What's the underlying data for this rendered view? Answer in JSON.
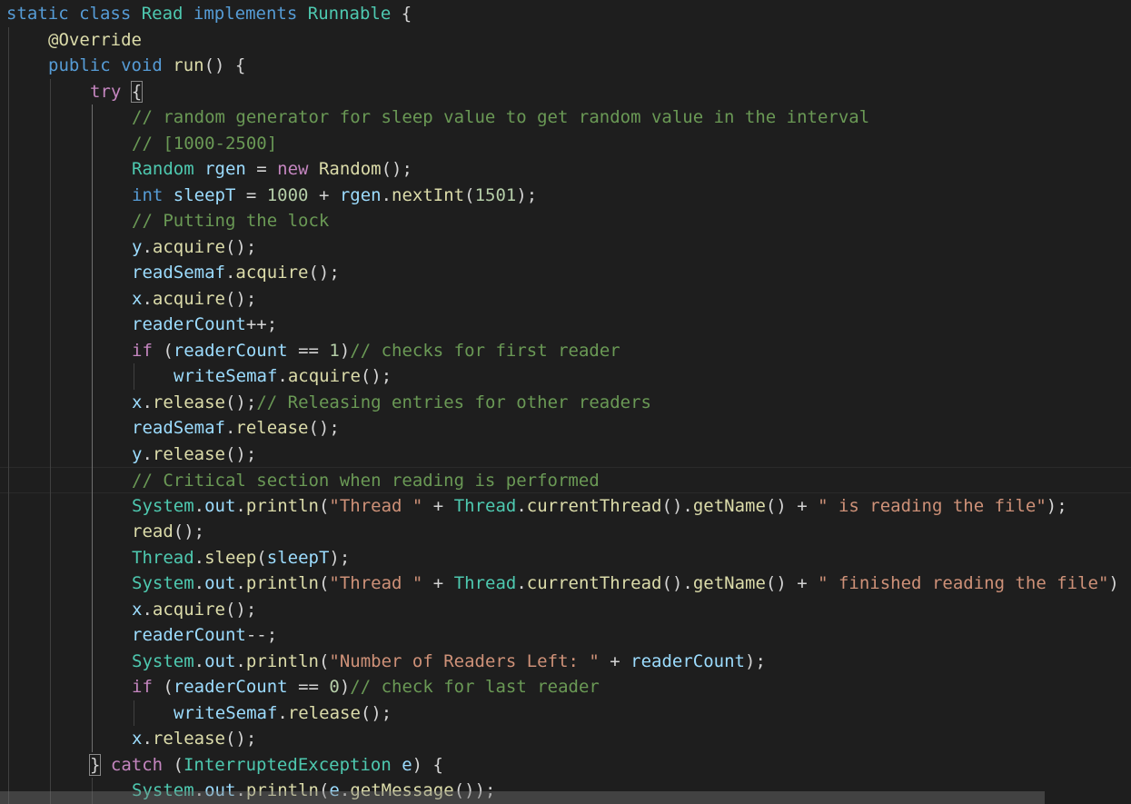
{
  "editor": {
    "language": "java",
    "lines": [
      {
        "indent": 0,
        "tokens": [
          [
            "kw",
            "static "
          ],
          [
            "kw",
            "class "
          ],
          [
            "type",
            "Read "
          ],
          [
            "kw",
            "implements "
          ],
          [
            "type",
            "Runnable"
          ],
          [
            "op",
            " {"
          ]
        ]
      },
      {
        "indent": 1,
        "tokens": [
          [
            "ann",
            "@Override"
          ]
        ]
      },
      {
        "indent": 1,
        "tokens": [
          [
            "kw",
            "public "
          ],
          [
            "kw",
            "void "
          ],
          [
            "fn",
            "run"
          ],
          [
            "op",
            "() {"
          ]
        ]
      },
      {
        "indent": 2,
        "tokens": [
          [
            "ctl",
            "try "
          ],
          [
            "brace",
            "{"
          ]
        ]
      },
      {
        "indent": 3,
        "tokens": [
          [
            "cmt",
            "// random generator for sleep value to get random value in the interval"
          ]
        ]
      },
      {
        "indent": 3,
        "tokens": [
          [
            "cmt",
            "// [1000-2500]"
          ]
        ]
      },
      {
        "indent": 3,
        "tokens": [
          [
            "type",
            "Random "
          ],
          [
            "var",
            "rgen"
          ],
          [
            "op",
            " = "
          ],
          [
            "ctl",
            "new "
          ],
          [
            "fn",
            "Random"
          ],
          [
            "op",
            "();"
          ]
        ]
      },
      {
        "indent": 3,
        "tokens": [
          [
            "kw",
            "int "
          ],
          [
            "var",
            "sleepT"
          ],
          [
            "op",
            " = "
          ],
          [
            "num",
            "1000"
          ],
          [
            "op",
            " + "
          ],
          [
            "var",
            "rgen"
          ],
          [
            "op",
            "."
          ],
          [
            "fn",
            "nextInt"
          ],
          [
            "op",
            "("
          ],
          [
            "num",
            "1501"
          ],
          [
            "op",
            ");"
          ]
        ]
      },
      {
        "indent": 3,
        "tokens": [
          [
            "cmt",
            "// Putting the lock"
          ]
        ]
      },
      {
        "indent": 3,
        "tokens": [
          [
            "var",
            "y"
          ],
          [
            "op",
            "."
          ],
          [
            "fn",
            "acquire"
          ],
          [
            "op",
            "();"
          ]
        ]
      },
      {
        "indent": 3,
        "tokens": [
          [
            "var",
            "readSemaf"
          ],
          [
            "op",
            "."
          ],
          [
            "fn",
            "acquire"
          ],
          [
            "op",
            "();"
          ]
        ]
      },
      {
        "indent": 3,
        "tokens": [
          [
            "var",
            "x"
          ],
          [
            "op",
            "."
          ],
          [
            "fn",
            "acquire"
          ],
          [
            "op",
            "();"
          ]
        ]
      },
      {
        "indent": 3,
        "tokens": [
          [
            "var",
            "readerCount"
          ],
          [
            "op",
            "++;"
          ]
        ]
      },
      {
        "indent": 3,
        "tokens": [
          [
            "ctl",
            "if "
          ],
          [
            "op",
            "("
          ],
          [
            "var",
            "readerCount"
          ],
          [
            "op",
            " == "
          ],
          [
            "num",
            "1"
          ],
          [
            "op",
            ")"
          ],
          [
            "cmt",
            "// checks for first reader"
          ]
        ]
      },
      {
        "indent": 4,
        "tokens": [
          [
            "var",
            "writeSemaf"
          ],
          [
            "op",
            "."
          ],
          [
            "fn",
            "acquire"
          ],
          [
            "op",
            "();"
          ]
        ]
      },
      {
        "indent": 3,
        "tokens": [
          [
            "var",
            "x"
          ],
          [
            "op",
            "."
          ],
          [
            "fn",
            "release"
          ],
          [
            "op",
            "();"
          ],
          [
            "cmt",
            "// Releasing entries for other readers"
          ]
        ]
      },
      {
        "indent": 3,
        "tokens": [
          [
            "var",
            "readSemaf"
          ],
          [
            "op",
            "."
          ],
          [
            "fn",
            "release"
          ],
          [
            "op",
            "();"
          ]
        ]
      },
      {
        "indent": 3,
        "tokens": [
          [
            "var",
            "y"
          ],
          [
            "op",
            "."
          ],
          [
            "fn",
            "release"
          ],
          [
            "op",
            "();"
          ]
        ]
      },
      {
        "indent": 3,
        "highlight": true,
        "tokens": [
          [
            "cmt",
            "// Critical section when reading is performed"
          ]
        ]
      },
      {
        "indent": 3,
        "tokens": [
          [
            "type",
            "System"
          ],
          [
            "op",
            "."
          ],
          [
            "var",
            "out"
          ],
          [
            "op",
            "."
          ],
          [
            "fn",
            "println"
          ],
          [
            "op",
            "("
          ],
          [
            "str",
            "\"Thread \""
          ],
          [
            "op",
            " + "
          ],
          [
            "type",
            "Thread"
          ],
          [
            "op",
            "."
          ],
          [
            "fn",
            "currentThread"
          ],
          [
            "op",
            "()."
          ],
          [
            "fn",
            "getName"
          ],
          [
            "op",
            "() + "
          ],
          [
            "str",
            "\" is reading the file\""
          ],
          [
            "op",
            ");"
          ]
        ]
      },
      {
        "indent": 3,
        "tokens": [
          [
            "fn",
            "read"
          ],
          [
            "op",
            "();"
          ]
        ]
      },
      {
        "indent": 3,
        "tokens": [
          [
            "type",
            "Thread"
          ],
          [
            "op",
            "."
          ],
          [
            "fn",
            "sleep"
          ],
          [
            "op",
            "("
          ],
          [
            "var",
            "sleepT"
          ],
          [
            "op",
            ");"
          ]
        ]
      },
      {
        "indent": 3,
        "tokens": [
          [
            "type",
            "System"
          ],
          [
            "op",
            "."
          ],
          [
            "var",
            "out"
          ],
          [
            "op",
            "."
          ],
          [
            "fn",
            "println"
          ],
          [
            "op",
            "("
          ],
          [
            "str",
            "\"Thread \""
          ],
          [
            "op",
            " + "
          ],
          [
            "type",
            "Thread"
          ],
          [
            "op",
            "."
          ],
          [
            "fn",
            "currentThread"
          ],
          [
            "op",
            "()."
          ],
          [
            "fn",
            "getName"
          ],
          [
            "op",
            "() + "
          ],
          [
            "str",
            "\" finished reading the file\""
          ],
          [
            "op",
            ")"
          ]
        ]
      },
      {
        "indent": 3,
        "tokens": [
          [
            "var",
            "x"
          ],
          [
            "op",
            "."
          ],
          [
            "fn",
            "acquire"
          ],
          [
            "op",
            "();"
          ]
        ]
      },
      {
        "indent": 3,
        "tokens": [
          [
            "var",
            "readerCount"
          ],
          [
            "op",
            "--;"
          ]
        ]
      },
      {
        "indent": 3,
        "tokens": [
          [
            "type",
            "System"
          ],
          [
            "op",
            "."
          ],
          [
            "var",
            "out"
          ],
          [
            "op",
            "."
          ],
          [
            "fn",
            "println"
          ],
          [
            "op",
            "("
          ],
          [
            "str",
            "\"Number of Readers Left: \""
          ],
          [
            "op",
            " + "
          ],
          [
            "var",
            "readerCount"
          ],
          [
            "op",
            ");"
          ]
        ]
      },
      {
        "indent": 3,
        "tokens": [
          [
            "ctl",
            "if "
          ],
          [
            "op",
            "("
          ],
          [
            "var",
            "readerCount"
          ],
          [
            "op",
            " == "
          ],
          [
            "num",
            "0"
          ],
          [
            "op",
            ")"
          ],
          [
            "cmt",
            "// check for last reader"
          ]
        ]
      },
      {
        "indent": 4,
        "tokens": [
          [
            "var",
            "writeSemaf"
          ],
          [
            "op",
            "."
          ],
          [
            "fn",
            "release"
          ],
          [
            "op",
            "();"
          ]
        ]
      },
      {
        "indent": 3,
        "tokens": [
          [
            "var",
            "x"
          ],
          [
            "op",
            "."
          ],
          [
            "fn",
            "release"
          ],
          [
            "op",
            "();"
          ]
        ]
      },
      {
        "indent": 2,
        "tokens": [
          [
            "brace",
            "}"
          ],
          [
            "ctl",
            " catch "
          ],
          [
            "op",
            "("
          ],
          [
            "type",
            "InterruptedException "
          ],
          [
            "var",
            "e"
          ],
          [
            "op",
            ") {"
          ]
        ]
      },
      {
        "indent": 3,
        "tokens": [
          [
            "type",
            "System"
          ],
          [
            "op",
            "."
          ],
          [
            "var",
            "out"
          ],
          [
            "op",
            "."
          ],
          [
            "fn",
            "println"
          ],
          [
            "op",
            "("
          ],
          [
            "var",
            "e"
          ],
          [
            "op",
            "."
          ],
          [
            "fn",
            "getMessage"
          ],
          [
            "op",
            "());"
          ]
        ]
      }
    ]
  }
}
